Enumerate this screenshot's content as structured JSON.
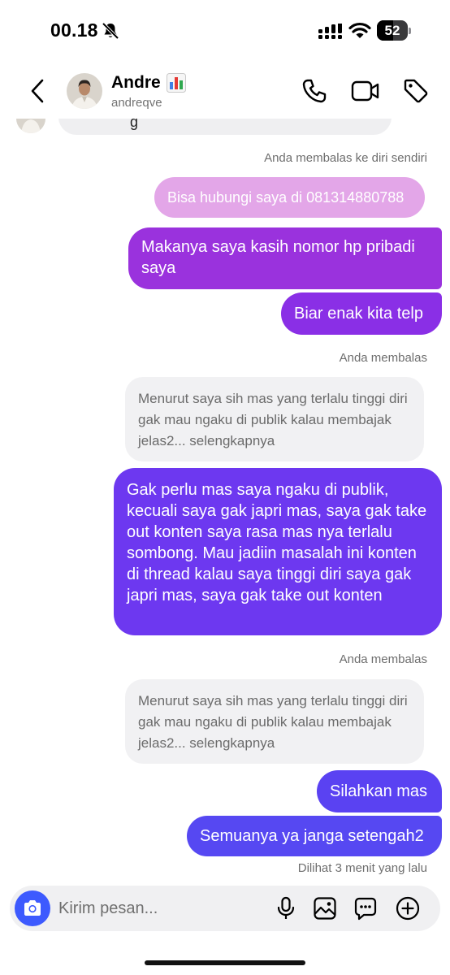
{
  "status_bar": {
    "time": "00.18",
    "battery": "52",
    "battery_level": 0.52,
    "icons": [
      "bell-slash-icon",
      "cellular-signal-icon",
      "wifi-icon",
      "battery-icon"
    ]
  },
  "header": {
    "name": "Andre",
    "username": "andreqve",
    "icons": [
      "back-icon",
      "bar-chart-emoji",
      "phone-icon",
      "video-camera-icon",
      "tag-icon"
    ]
  },
  "thread": {
    "top_fragment": "g",
    "replied_self_label": "Anda membalas ke diri sendiri",
    "reply_quote_1": "Bisa hubungi saya di 081314880788",
    "message_1": "Makanya saya kasih nomor hp pribadi saya",
    "message_2": "Biar enak kita telp",
    "replied_label_1": "Anda membalas",
    "quote_1": "Menurut saya sih mas yang terlalu tinggi diri gak mau ngaku di publik kalau membajak jelas2... selengkapnya",
    "message_3": "Gak perlu mas saya ngaku di publik, kecuali saya gak japri mas, saya gak take out konten saya rasa mas nya terlalu sombong. Mau jadiin masalah ini konten di thread kalau saya tinggi diri saya gak japri mas, saya gak take out konten",
    "replied_label_2": "Anda membalas",
    "quote_2": "Menurut saya sih mas yang terlalu tinggi diri gak mau ngaku di publik kalau membajak jelas2... selengkapnya",
    "message_4": "Silahkan mas",
    "message_5": "Semuanya ya janga setengah2",
    "seen_label": "Dilihat 3 menit yang lalu"
  },
  "composer": {
    "placeholder": "Kirim pesan...",
    "icons": [
      "camera-icon",
      "microphone-icon",
      "gallery-icon",
      "sticker-icon",
      "plus-icon"
    ]
  },
  "colors": {
    "accent_blue": "#3d5afe",
    "bubble_purple": "#9a32dd",
    "bubble_violet": "#6d38f0",
    "bubble_indigo": "#5648f2",
    "quote_pink": "#e3a6e8"
  }
}
